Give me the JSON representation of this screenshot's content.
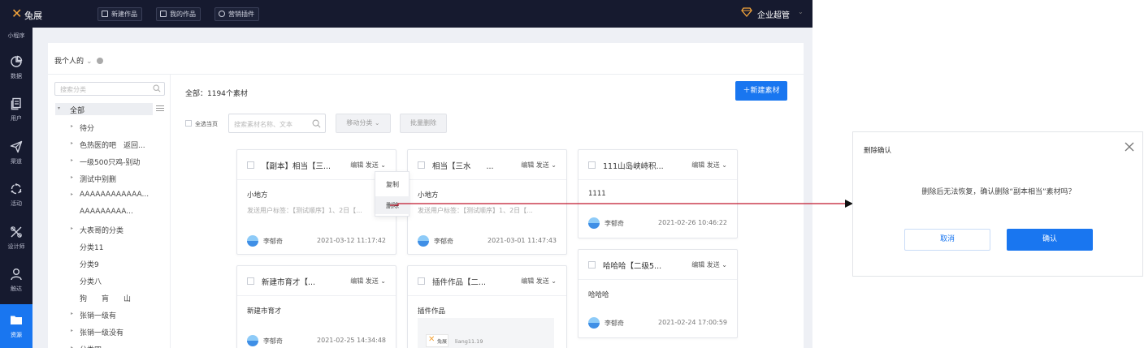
{
  "brand": {
    "name": "兔展"
  },
  "topbar": {
    "buttons": [
      "新建作品",
      "我的作品",
      "营销插件"
    ],
    "enterprise_label": "企业超管"
  },
  "nav": {
    "top_label": "小程序",
    "items": [
      {
        "label": "数据",
        "icon": "pie-chart-icon"
      },
      {
        "label": "用户",
        "icon": "documents-icon"
      },
      {
        "label": "渠道",
        "icon": "paper-plane-icon"
      },
      {
        "label": "活动",
        "icon": "activity-icon"
      },
      {
        "label": "设计师",
        "icon": "design-icon"
      },
      {
        "label": "触达",
        "icon": "user-icon"
      },
      {
        "label": "资源",
        "icon": "folder-icon",
        "active": true
      }
    ]
  },
  "panel": {
    "scope_label": "我个人的",
    "tree": {
      "search_placeholder": "搜索分类",
      "root_label": "全部",
      "nodes": [
        {
          "label": "待分",
          "arrow": true
        },
        {
          "label": "色热医的吧　返回...",
          "arrow": true
        },
        {
          "label": "一级500只鸡-别动",
          "arrow": true
        },
        {
          "label": "测试中别删",
          "arrow": true
        },
        {
          "label": "AAAAAAAAAAAA...",
          "arrow": true
        },
        {
          "label": "AAAAAAAAA...",
          "arrow": false
        },
        {
          "label": "大表哥的分类",
          "arrow": true
        },
        {
          "label": "分类11",
          "arrow": false
        },
        {
          "label": "分类9",
          "arrow": false
        },
        {
          "label": "分类八",
          "arrow": false
        },
        {
          "label": "狗　　肓　　山",
          "arrow": false
        },
        {
          "label": "张销一级有",
          "arrow": true
        },
        {
          "label": "张销一级没有",
          "arrow": true
        },
        {
          "label": "分类四",
          "arrow": true
        }
      ]
    },
    "count_label": "全部：1194个素材",
    "new_button": "＋新建素材",
    "select_all_label": "全选当页",
    "search_placeholder": "搜索素材名称、文本",
    "move_button": "移动分类 ⌄",
    "batch_delete_button": "批量删除"
  },
  "cards": [
    {
      "title": "【副本】相当【三...",
      "actions": "编辑 发送 ⌄",
      "sub": "小地方",
      "desc": "发送用户标签：【测试顺序】1、2日【...",
      "author": "李郁奇",
      "date": "2021-03-12 11:17:42"
    },
    {
      "title": "相当【三水　　...",
      "actions": "编辑 发送 ⌄",
      "sub": "小地方",
      "desc": "发送用户标签：【测试顺序】1、2日【...",
      "author": "李郁奇",
      "date": "2021-03-01 11:47:43"
    },
    {
      "title": "111山岛峡峙积...",
      "actions": "编辑 发送 ⌄",
      "sub": "1111",
      "author": "李郁奇",
      "date": "2021-02-26 10:46:22"
    },
    {
      "title": "新建市育才【...",
      "actions": "编辑 发送 ⌄",
      "sub": "新建市育才",
      "author": "李郁奇",
      "date": "2021-02-25 14:34:48"
    },
    {
      "title": "插件作品【二...",
      "actions": "编辑 发送 ⌄",
      "sub": "插件作品",
      "thumb_brand": "兔展",
      "thumb_name": "liang11.19"
    },
    {
      "title": "哈哈哈【二级5...",
      "actions": "编辑 发送 ⌄",
      "sub": "哈哈哈",
      "author": "李郁奇",
      "date": "2021-02-24 17:00:59"
    }
  ],
  "dropdown": {
    "copy_label": "复制",
    "delete_label": "删除"
  },
  "dialog": {
    "title": "删除确认",
    "message": "删除后无法恢复，确认删除“副本相当”素材吗？",
    "cancel_label": "取消",
    "confirm_label": "确认"
  },
  "colors": {
    "accent": "#1976f0",
    "dark_bar": "#161a2f",
    "logo": "#f3a43b",
    "connector": "#c0182e"
  }
}
